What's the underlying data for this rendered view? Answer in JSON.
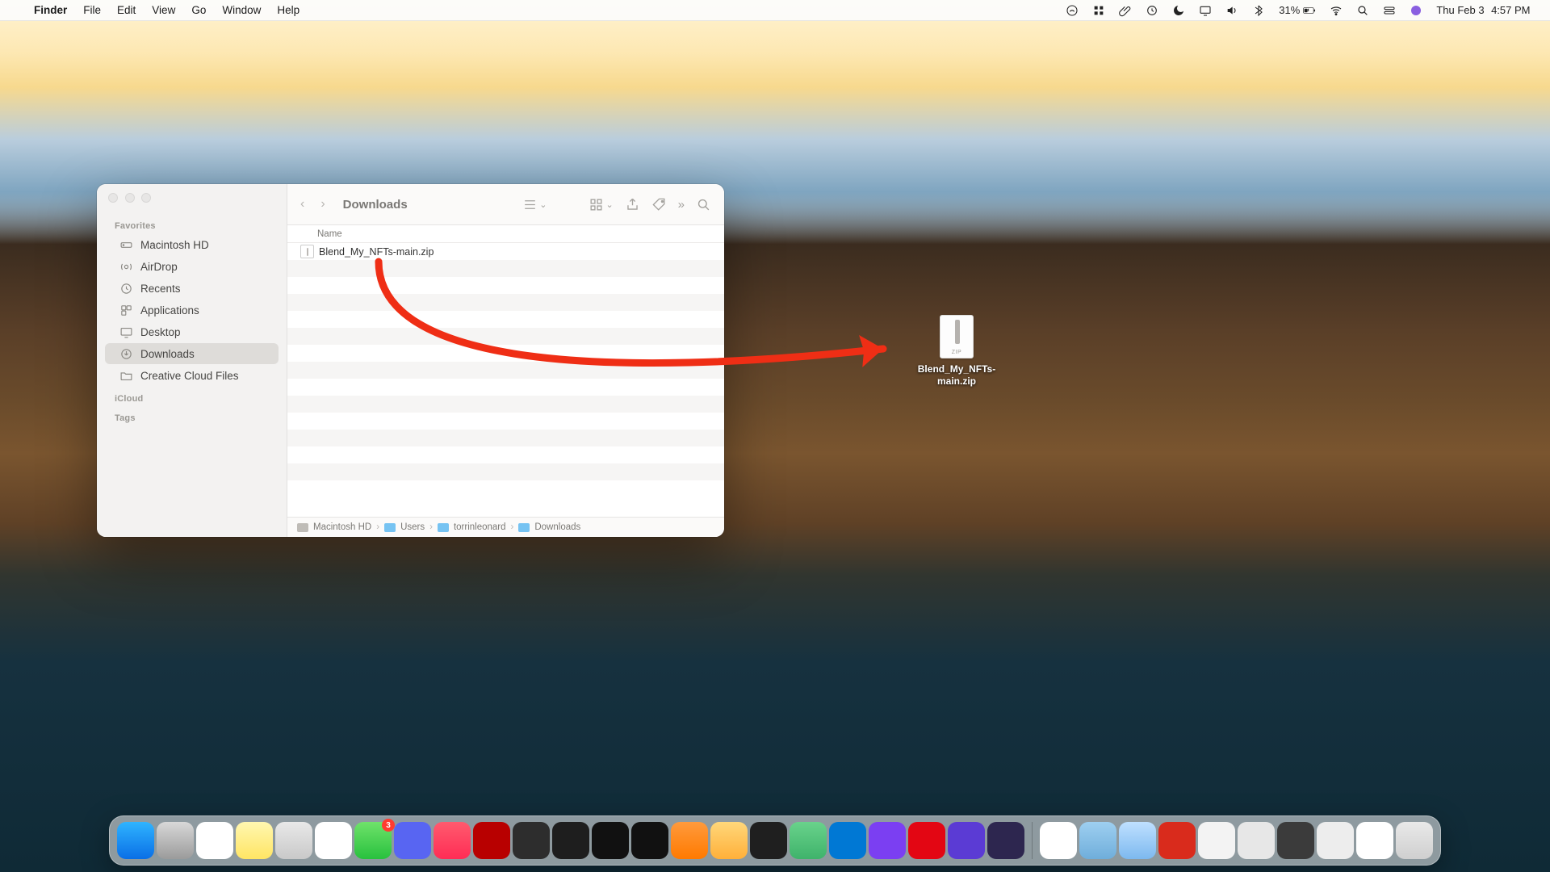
{
  "menubar": {
    "app": "Finder",
    "items": [
      "File",
      "Edit",
      "View",
      "Go",
      "Window",
      "Help"
    ],
    "battery_pct": "31%",
    "date": "Thu Feb 3",
    "time": "4:57 PM"
  },
  "finder": {
    "title": "Downloads",
    "sidebar": {
      "favorites_label": "Favorites",
      "icloud_label": "iCloud",
      "tags_label": "Tags",
      "items": [
        {
          "label": "Macintosh HD",
          "icon": "hdd"
        },
        {
          "label": "AirDrop",
          "icon": "airdrop"
        },
        {
          "label": "Recents",
          "icon": "clock"
        },
        {
          "label": "Applications",
          "icon": "apps"
        },
        {
          "label": "Desktop",
          "icon": "desktop"
        },
        {
          "label": "Downloads",
          "icon": "downloads",
          "selected": true
        },
        {
          "label": "Creative Cloud Files",
          "icon": "folder"
        }
      ]
    },
    "column_header": "Name",
    "files": [
      {
        "name": "Blend_My_NFTs-main.zip"
      }
    ],
    "path": [
      "Macintosh HD",
      "Users",
      "torrinleonard",
      "Downloads"
    ]
  },
  "desktop_file": {
    "label": "Blend_My_NFTs-main.zip"
  },
  "dock": {
    "apps": [
      {
        "name": "finder",
        "color": "linear-gradient(#2fb4ff,#0a6fe6)"
      },
      {
        "name": "settings",
        "color": "linear-gradient(#d8d8d8,#9b9b9b)"
      },
      {
        "name": "reminders",
        "color": "#fff"
      },
      {
        "name": "notes",
        "color": "linear-gradient(#fff7b0,#ffe564)"
      },
      {
        "name": "launchpad",
        "color": "linear-gradient(#e8e8e8,#c9c9c9)"
      },
      {
        "name": "chrome",
        "color": "#fff"
      },
      {
        "name": "messages",
        "color": "linear-gradient(#6fe26a,#28c13e)",
        "badge": "3"
      },
      {
        "name": "discord",
        "color": "#5865f2"
      },
      {
        "name": "music",
        "color": "linear-gradient(#ff5a6e,#ff2d55)"
      },
      {
        "name": "filezilla",
        "color": "#b80000"
      },
      {
        "name": "obs",
        "color": "#2d2d2d"
      },
      {
        "name": "terminal",
        "color": "#1e1e1e"
      },
      {
        "name": "iterm",
        "color": "#111"
      },
      {
        "name": "iterm2",
        "color": "#111"
      },
      {
        "name": "blender",
        "color": "linear-gradient(#ff9a3c,#ff7a00)"
      },
      {
        "name": "sublime",
        "color": "linear-gradient(#ffd77a,#ffb03a)"
      },
      {
        "name": "pycharm",
        "color": "#1f1f1f"
      },
      {
        "name": "atom",
        "color": "linear-gradient(#69d28b,#3fb36b)"
      },
      {
        "name": "vscode",
        "color": "#0078d4"
      },
      {
        "name": "github",
        "color": "#7b3ff2"
      },
      {
        "name": "avira",
        "color": "#e30613"
      },
      {
        "name": "app-x",
        "color": "#5b3bd4"
      },
      {
        "name": "app-tn",
        "color": "#2d264f"
      }
    ],
    "right": [
      {
        "name": "textedit",
        "color": "#fff"
      },
      {
        "name": "downloads-stack",
        "color": "linear-gradient(#9ecff0,#6faedb)"
      },
      {
        "name": "screenshot",
        "color": "linear-gradient(#bfe0ff,#7db9ef)"
      },
      {
        "name": "adblock",
        "color": "#d92b1c"
      },
      {
        "name": "doc-1",
        "color": "#f3f3f3"
      },
      {
        "name": "doc-2",
        "color": "#e7e7e7"
      },
      {
        "name": "doc-3",
        "color": "#3b3b3b"
      },
      {
        "name": "doc-4",
        "color": "#ededed"
      },
      {
        "name": "doc-5",
        "color": "#fff"
      },
      {
        "name": "trash",
        "color": "linear-gradient(#e9e9e9,#cfcfcf)"
      }
    ]
  }
}
